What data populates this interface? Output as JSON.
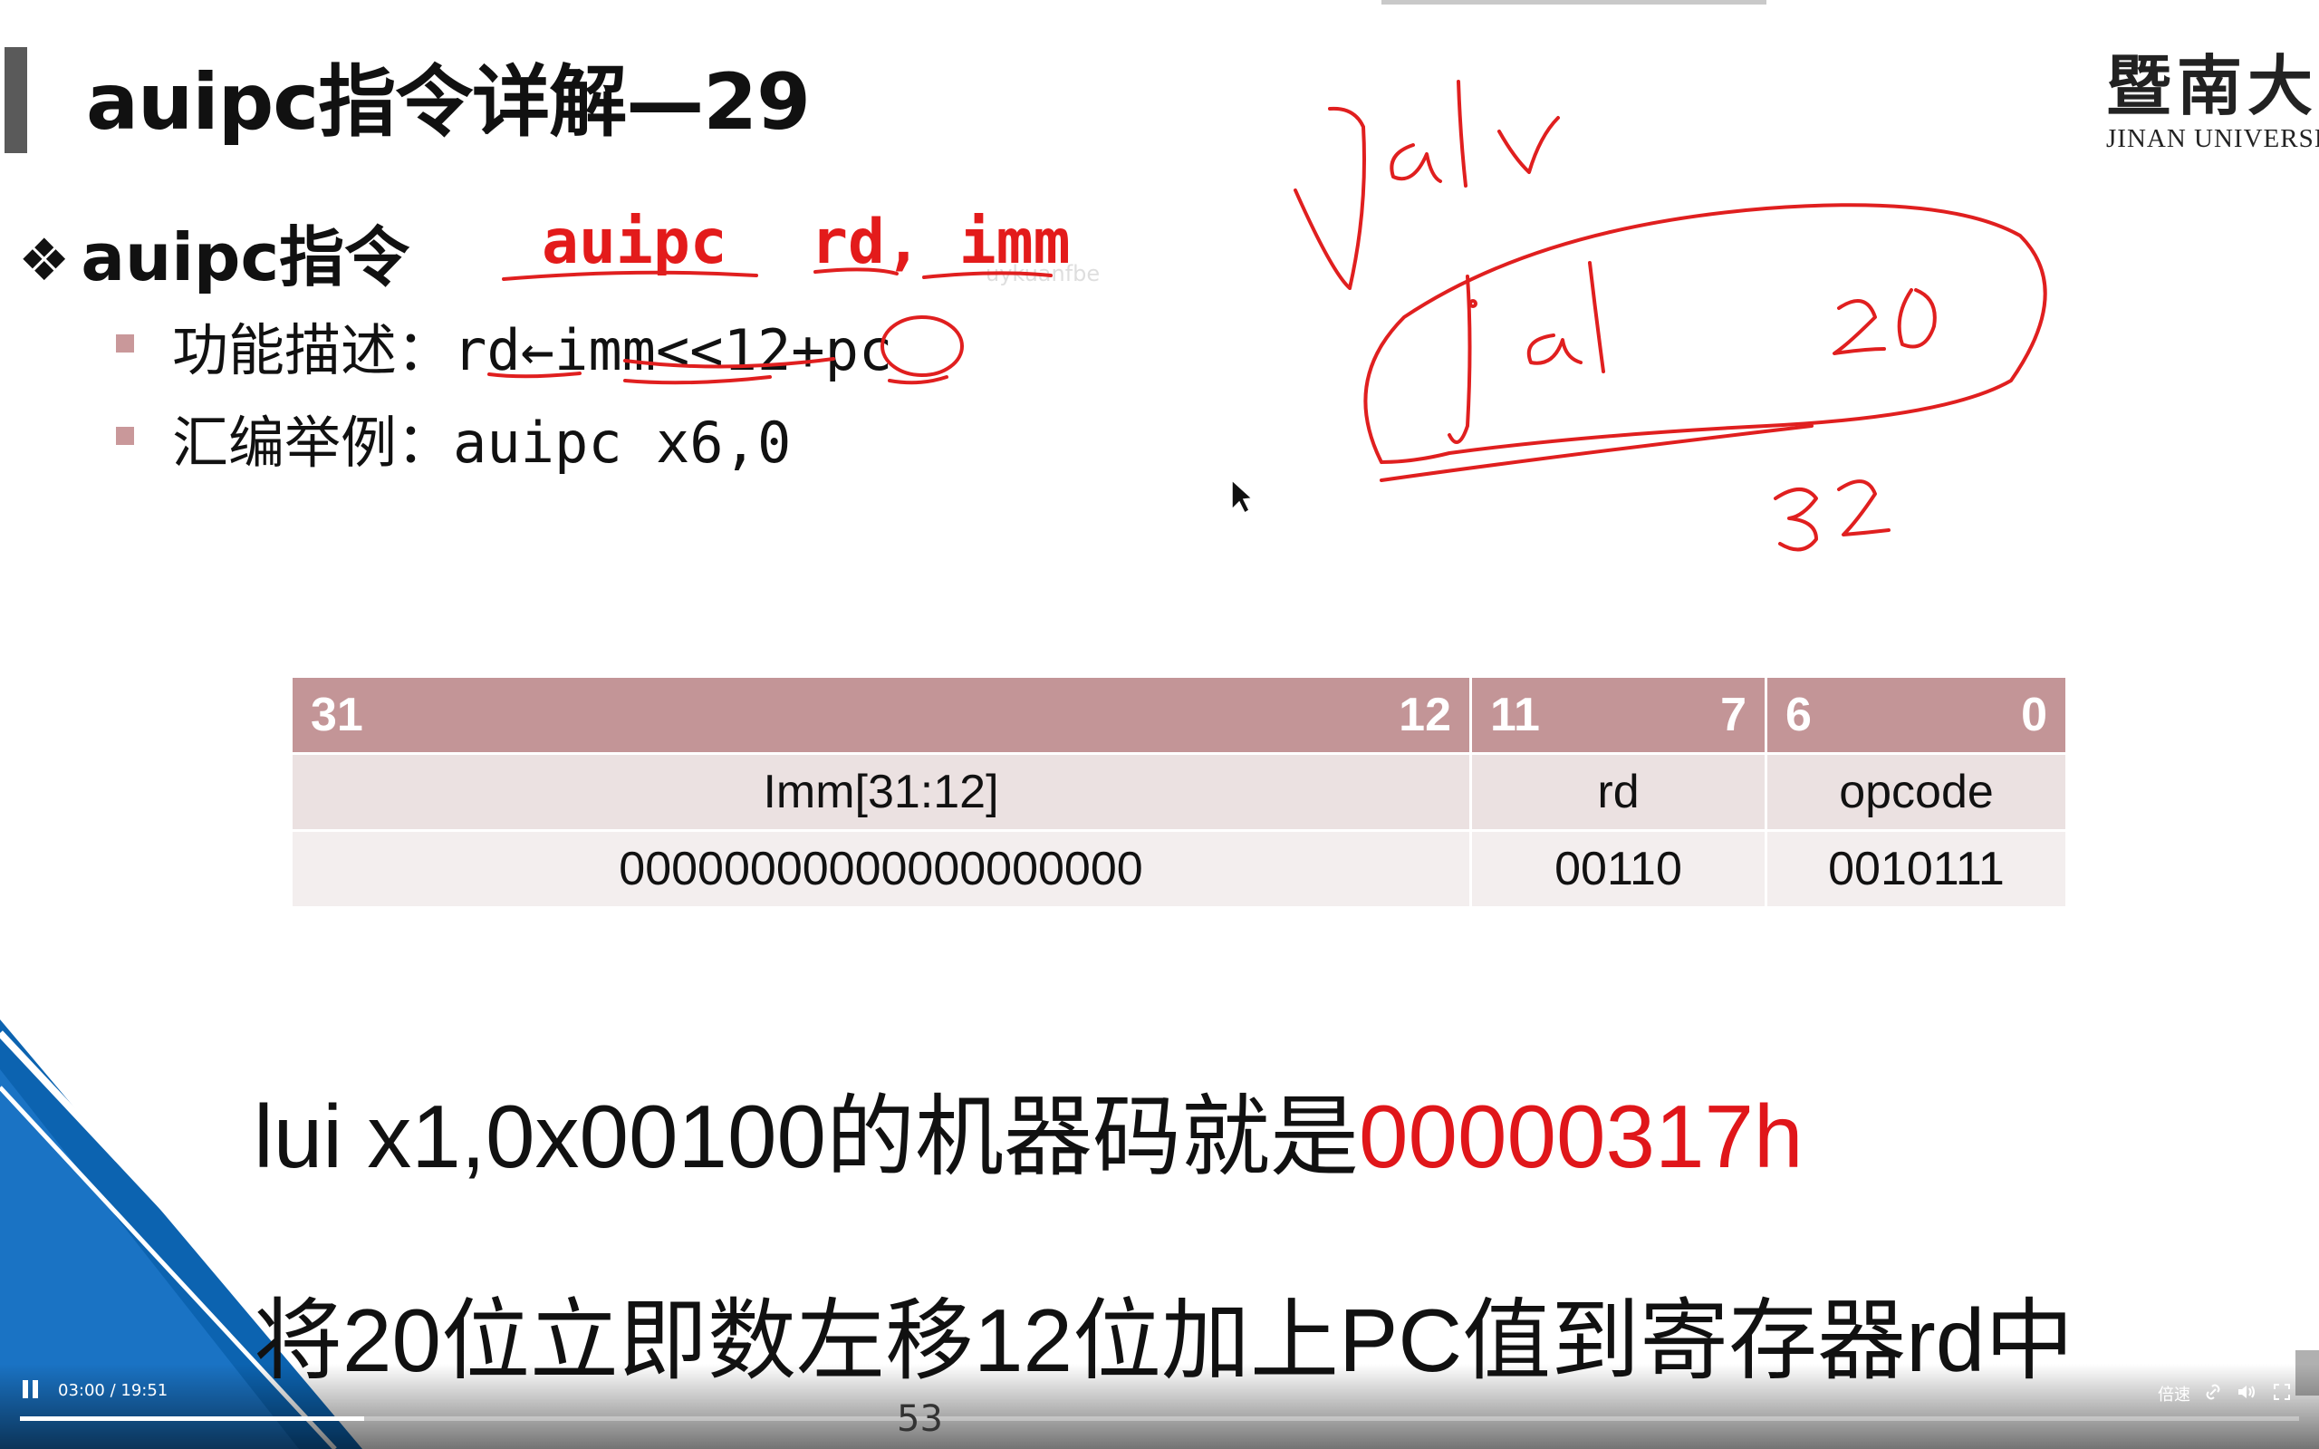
{
  "slide": {
    "title": "auipc指令详解—29",
    "logo": {
      "cn": "暨南大学",
      "en": "JINAN UNIVERSITY"
    },
    "main_bullet": {
      "symbol": "❖",
      "text": "auipc指令"
    },
    "syntax": {
      "mnemonic": "auipc",
      "operands": "rd, imm"
    },
    "bullets": [
      {
        "label": "功能描述：",
        "code": "rd←imm<<12+pc"
      },
      {
        "label": "汇编举例：",
        "code": "auipc x6,0"
      }
    ],
    "encoding_table": {
      "header": [
        {
          "left": "31",
          "right": "12"
        },
        {
          "left": "11",
          "right": "7"
        },
        {
          "left": "6",
          "right": "0"
        }
      ],
      "field_row": [
        "Imm[31:12]",
        "rd",
        "opcode"
      ],
      "value_row": [
        "00000000000000000000",
        "00110",
        "0010111"
      ]
    },
    "caption_line1": {
      "text": "lui x1,0x00100的机器码就是",
      "highlight": "00000317h"
    },
    "caption_line2": "将20位立即数左移12位加上PC值到寄存器rd中",
    "handwriting": {
      "jalr": "jalr",
      "jal": "jal",
      "num20": "20",
      "num32": "32"
    },
    "colors": {
      "accent_red": "#e31b1b",
      "table_header": "#c39597",
      "table_row1": "#ebe1e1",
      "table_row2": "#f3eeee",
      "blue_deco": "#0c63b0"
    }
  },
  "player": {
    "time": "03:00 / 19:51",
    "progress": 0.151,
    "page_number": "53",
    "speed_label": "倍速",
    "icons": [
      "pause-icon",
      "link-icon",
      "volume-icon",
      "fullscreen-icon"
    ]
  }
}
